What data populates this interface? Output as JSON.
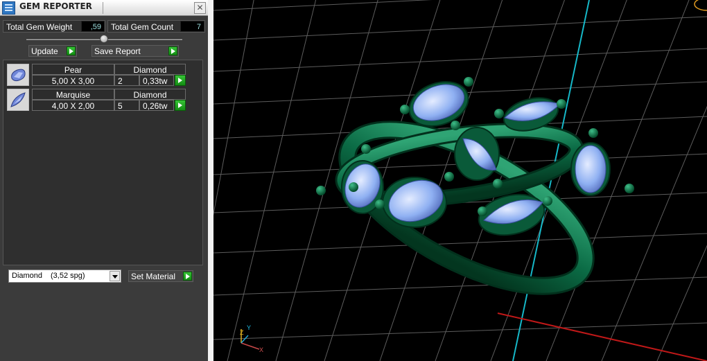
{
  "window": {
    "title": "GEM REPORTER",
    "close_glyph": "✕"
  },
  "summary": {
    "weight_label": "Total Gem Weight",
    "weight_value": ",59",
    "count_label": "Total Gem Count",
    "count_value": "7"
  },
  "actions": {
    "update_label": "Update",
    "save_label": "Save Report"
  },
  "gems": [
    {
      "shape": "Pear",
      "material": "Diamond",
      "size": "5,00 X 3,00",
      "qty": "2",
      "weight": "0,33tw"
    },
    {
      "shape": "Marquise",
      "material": "Diamond",
      "size": "4,00 X 2,00",
      "qty": "5",
      "weight": "0,26tw"
    }
  ],
  "material_select": {
    "name": "Diamond",
    "density": "(3,52 spg)"
  },
  "set_material_label": "Set Material",
  "axis_labels": {
    "z": "Z",
    "y": "Y",
    "x": "X"
  },
  "colors": {
    "metal": "#0b6b45",
    "gem": "#8fb0f2",
    "grid": "#7a7a7a",
    "axis_y": "#16b8c8",
    "axis_x": "#c01818",
    "go_button": "#22a822"
  },
  "icons": [
    "app-icon",
    "close-icon",
    "go-arrow-icon",
    "dropdown-arrow-icon",
    "pear-gem-icon",
    "marquise-gem-icon"
  ]
}
